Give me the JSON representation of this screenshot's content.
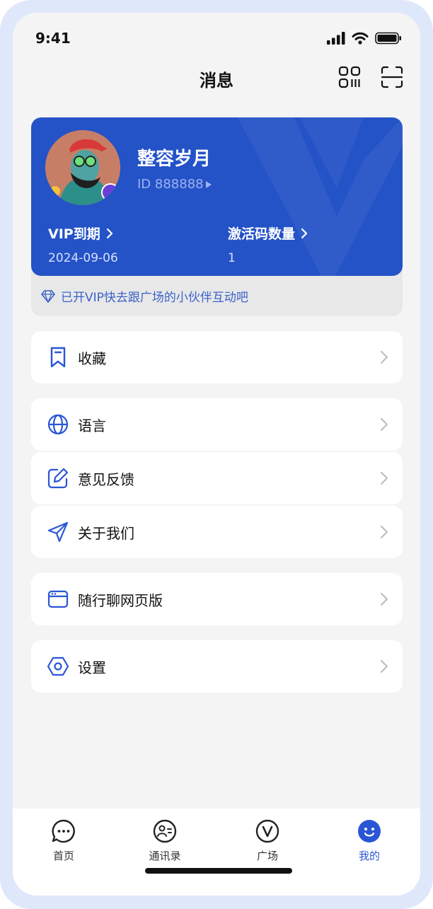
{
  "status_bar": {
    "time": "9:41"
  },
  "header": {
    "title": "消息",
    "icons": [
      "qr-code-icon",
      "scan-icon"
    ]
  },
  "profile": {
    "name": "整容岁月",
    "id_text": "ID 888888",
    "vip_expiry": {
      "label": "VIP到期",
      "value": "2024-09-06"
    },
    "activation_codes": {
      "label": "激活码数量",
      "value": "1"
    },
    "tip": "已开VIP快去跟广场的小伙伴互动吧"
  },
  "menu": [
    {
      "label": "收藏",
      "icon": "bookmark-icon"
    },
    {
      "label": "语言",
      "icon": "globe-icon"
    },
    {
      "label": "意见反馈",
      "icon": "edit-icon"
    },
    {
      "label": "关于我们",
      "icon": "send-icon"
    },
    {
      "label": "随行聊网页版",
      "icon": "browser-window-icon"
    },
    {
      "label": "设置",
      "icon": "settings-hexagon-icon"
    }
  ],
  "tabs": [
    {
      "label": "首页",
      "icon": "chat-bubble-icon",
      "active": false
    },
    {
      "label": "通讯录",
      "icon": "contacts-icon",
      "active": false
    },
    {
      "label": "广场",
      "icon": "v-circle-icon",
      "active": false
    },
    {
      "label": "我的",
      "icon": "smiley-icon",
      "active": true
    }
  ],
  "colors": {
    "accent": "#2a56d6",
    "card": "#2452c7",
    "background": "#f4f4f4"
  }
}
